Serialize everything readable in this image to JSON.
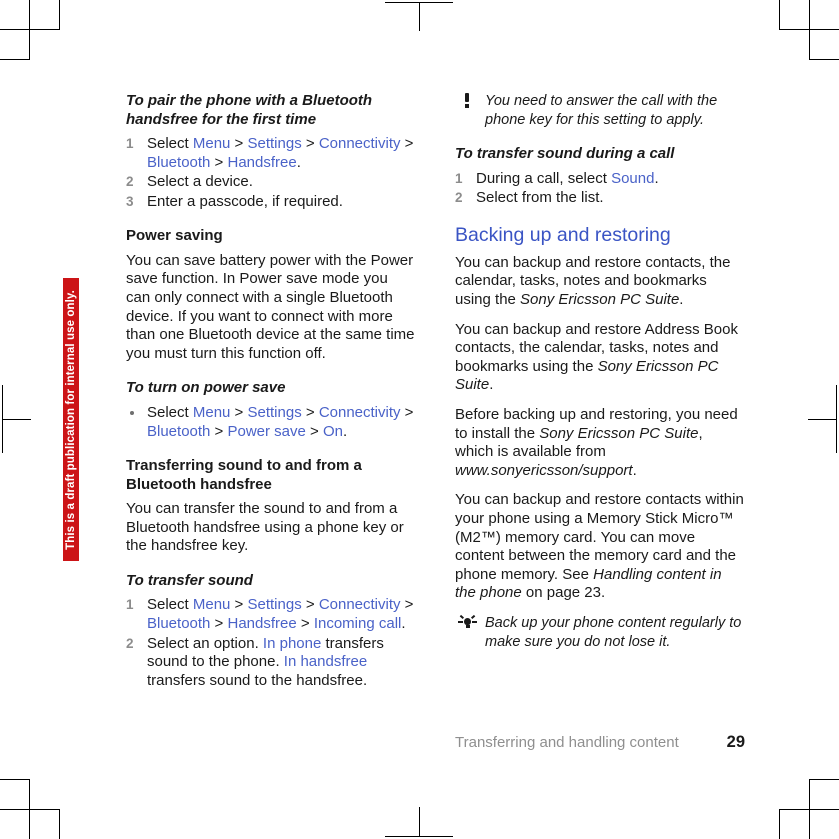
{
  "watermark": {
    "text": "This is a draft publication for internal use only.",
    "background": "#cc1417",
    "color": "#ffffff"
  },
  "colors": {
    "link": "#4a62c8",
    "heading": "#3a54c4",
    "step_number": "#8c8c8c",
    "footer_chapter": "#8f8f8f",
    "body": "#1a1a1a"
  },
  "left_column": {
    "proc_pair": {
      "title": "To pair the phone with a Bluetooth handsfree for the first time",
      "steps": [
        {
          "num": "1",
          "parts": [
            {
              "text": "Select ",
              "style": "plain"
            },
            {
              "text": "Menu",
              "style": "link"
            },
            {
              "text": " > ",
              "style": "plain"
            },
            {
              "text": "Settings",
              "style": "link"
            },
            {
              "text": " > ",
              "style": "plain"
            },
            {
              "text": "Connectivity",
              "style": "link"
            },
            {
              "text": " > ",
              "style": "plain"
            },
            {
              "text": "Bluetooth",
              "style": "link"
            },
            {
              "text": " > ",
              "style": "plain"
            },
            {
              "text": "Handsfree",
              "style": "link"
            },
            {
              "text": ".",
              "style": "plain"
            }
          ]
        },
        {
          "num": "2",
          "parts": [
            {
              "text": "Select a device.",
              "style": "plain"
            }
          ]
        },
        {
          "num": "3",
          "parts": [
            {
              "text": "Enter a passcode, if required.",
              "style": "plain"
            }
          ]
        }
      ]
    },
    "power_saving": {
      "heading": "Power saving",
      "body": "You can save battery power with the Power save function. In Power save mode you can only connect with a single Bluetooth device. If you want to connect with more than one Bluetooth device at the same time you must turn this function off."
    },
    "proc_power_save": {
      "title": "To turn on power save",
      "steps": [
        {
          "bullet": "•",
          "parts": [
            {
              "text": "Select ",
              "style": "plain"
            },
            {
              "text": "Menu",
              "style": "link"
            },
            {
              "text": " > ",
              "style": "plain"
            },
            {
              "text": "Settings",
              "style": "link"
            },
            {
              "text": " > ",
              "style": "plain"
            },
            {
              "text": "Connectivity",
              "style": "link"
            },
            {
              "text": " > ",
              "style": "plain"
            },
            {
              "text": "Bluetooth",
              "style": "link"
            },
            {
              "text": " > ",
              "style": "plain"
            },
            {
              "text": "Power save",
              "style": "link"
            },
            {
              "text": " > ",
              "style": "plain"
            },
            {
              "text": "On",
              "style": "link"
            },
            {
              "text": ".",
              "style": "plain"
            }
          ]
        }
      ]
    },
    "transferring_sound": {
      "heading": "Transferring sound to and from a Bluetooth handsfree",
      "body": "You can transfer the sound to and from a Bluetooth handsfree using a phone key or the handsfree key."
    },
    "proc_transfer_sound": {
      "title": "To transfer sound",
      "steps": [
        {
          "num": "1",
          "parts": [
            {
              "text": "Select ",
              "style": "plain"
            },
            {
              "text": "Menu",
              "style": "link"
            },
            {
              "text": " > ",
              "style": "plain"
            },
            {
              "text": "Settings",
              "style": "link"
            },
            {
              "text": " > ",
              "style": "plain"
            },
            {
              "text": "Connectivity",
              "style": "link"
            },
            {
              "text": " > ",
              "style": "plain"
            },
            {
              "text": "Bluetooth",
              "style": "link"
            },
            {
              "text": " > ",
              "style": "plain"
            },
            {
              "text": "Handsfree",
              "style": "link"
            },
            {
              "text": " > ",
              "style": "plain"
            },
            {
              "text": "Incoming call",
              "style": "link"
            },
            {
              "text": ".",
              "style": "plain"
            }
          ]
        },
        {
          "num": "2",
          "parts": [
            {
              "text": "Select an option. ",
              "style": "plain"
            },
            {
              "text": "In phone",
              "style": "link"
            },
            {
              "text": " transfers sound to the phone. ",
              "style": "plain"
            },
            {
              "text": "In handsfree",
              "style": "link"
            },
            {
              "text": " transfers sound to the handsfree.",
              "style": "plain"
            }
          ]
        }
      ]
    }
  },
  "right_column": {
    "note": {
      "icon": "exclamation-icon",
      "text": "You need to answer the call with the phone key for this setting to apply."
    },
    "proc_transfer_during_call": {
      "title": "To transfer sound during a call",
      "steps": [
        {
          "num": "1",
          "parts": [
            {
              "text": "During a call, select ",
              "style": "plain"
            },
            {
              "text": "Sound",
              "style": "link"
            },
            {
              "text": ".",
              "style": "plain"
            }
          ]
        },
        {
          "num": "2",
          "parts": [
            {
              "text": "Select from the list.",
              "style": "plain"
            }
          ]
        }
      ]
    },
    "backing_up": {
      "heading": "Backing up and restoring",
      "paragraphs": [
        [
          {
            "text": "You can backup and restore contacts, the calendar, tasks, notes and bookmarks using the ",
            "style": "plain"
          },
          {
            "text": "Sony Ericsson PC Suite",
            "style": "italic"
          },
          {
            "text": ".",
            "style": "plain"
          }
        ],
        [
          {
            "text": "You can backup and restore Address Book contacts, the calendar, tasks, notes and bookmarks using the ",
            "style": "plain"
          },
          {
            "text": "Sony Ericsson PC Suite",
            "style": "italic"
          },
          {
            "text": ".",
            "style": "plain"
          }
        ],
        [
          {
            "text": "Before backing up and restoring, you need to install the ",
            "style": "plain"
          },
          {
            "text": "Sony Ericsson PC Suite",
            "style": "italic"
          },
          {
            "text": ", which is available from ",
            "style": "plain"
          },
          {
            "text": "www.sonyericsson/support",
            "style": "italic"
          },
          {
            "text": ".",
            "style": "plain"
          }
        ],
        [
          {
            "text": "You can backup and restore contacts within your phone using a Memory Stick Micro™ (M2™) memory card. You can move content between the memory card and the phone memory. See ",
            "style": "plain"
          },
          {
            "text": "Handling content in the phone",
            "style": "italic"
          },
          {
            "text": " on page 23.",
            "style": "plain"
          }
        ]
      ]
    },
    "tip": {
      "icon": "lightbulb-icon",
      "text": "Back up your phone content regularly to make sure you do not lose it."
    }
  },
  "footer": {
    "chapter": "Transferring and handling content",
    "page_number": "29"
  }
}
